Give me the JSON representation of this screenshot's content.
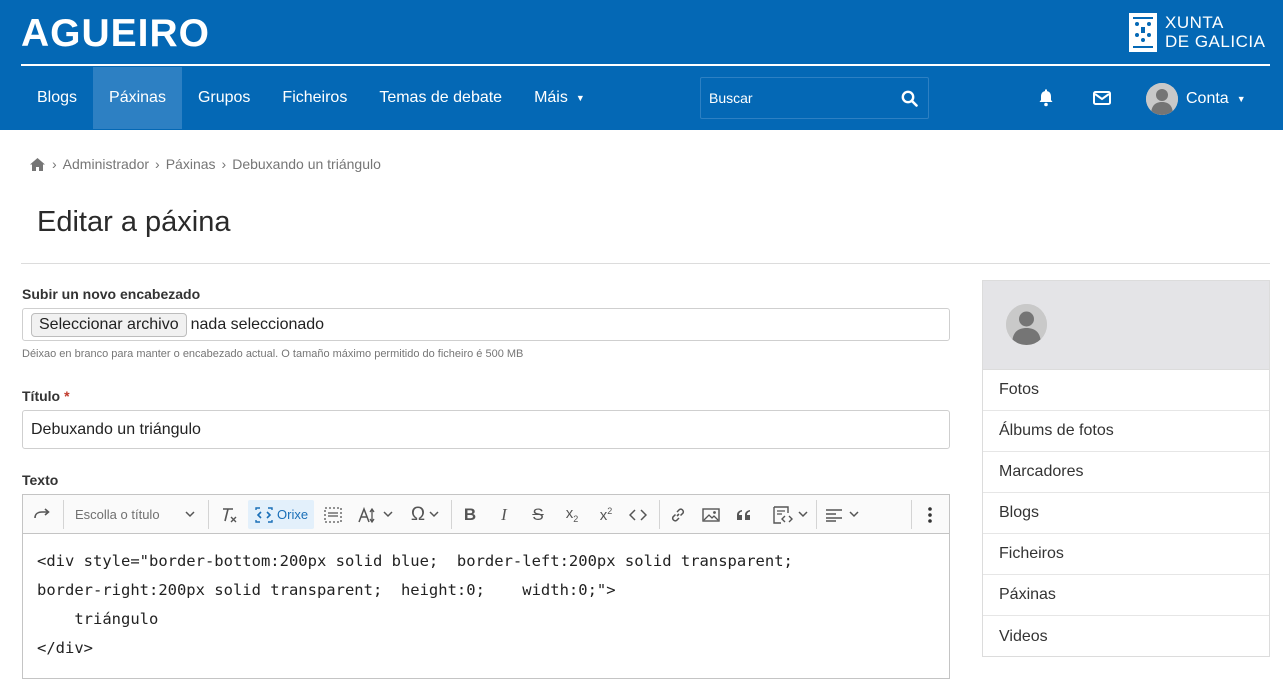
{
  "brand": {
    "name": "AGUEIRO",
    "gov_line1": "XUNTA",
    "gov_line2": "DE GALICIA"
  },
  "nav": {
    "items": [
      {
        "label": "Blogs"
      },
      {
        "label": "Páxinas",
        "active": true
      },
      {
        "label": "Grupos"
      },
      {
        "label": "Ficheiros"
      },
      {
        "label": "Temas de debate"
      },
      {
        "label": "Máis"
      }
    ],
    "search_placeholder": "Buscar",
    "account_label": "Conta",
    "icons": [
      "home-icon",
      "search-icon",
      "bell-icon",
      "mail-icon",
      "chevron-down-icon"
    ]
  },
  "breadcrumb": {
    "items": [
      "Administrador",
      "Páxinas",
      "Debuxando un triángulo"
    ]
  },
  "page": {
    "title": "Editar a páxina"
  },
  "form": {
    "header_label": "Subir un novo encabezado",
    "file_button": "Seleccionar archivo",
    "file_status": "nada seleccionado",
    "header_help": "Déixao en branco para manter o encabezado actual. O tamaño máximo permitido do ficheiro é 500 MB",
    "title_label": "Título",
    "title_required_mark": "*",
    "title_value": "Debuxando un triángulo",
    "text_label": "Texto",
    "editor": {
      "heading_select": "Escolla o título",
      "source_label": "Orixe",
      "code_lines": [
        "<div style=\"border-bottom:200px solid blue;  border-left:200px solid transparent;",
        "border-right:200px solid transparent;  height:0;    width:0;\">",
        "    triángulo",
        "</div>"
      ]
    }
  },
  "sidebar": {
    "items": [
      {
        "label": "Fotos"
      },
      {
        "label": "Álbums de fotos"
      },
      {
        "label": "Marcadores"
      },
      {
        "label": "Blogs"
      },
      {
        "label": "Ficheiros"
      },
      {
        "label": "Páxinas"
      },
      {
        "label": "Videos"
      }
    ]
  },
  "colors": {
    "brand_blue": "#0468b5",
    "active_nav": "#2d80c3",
    "required": "#c0392b"
  }
}
